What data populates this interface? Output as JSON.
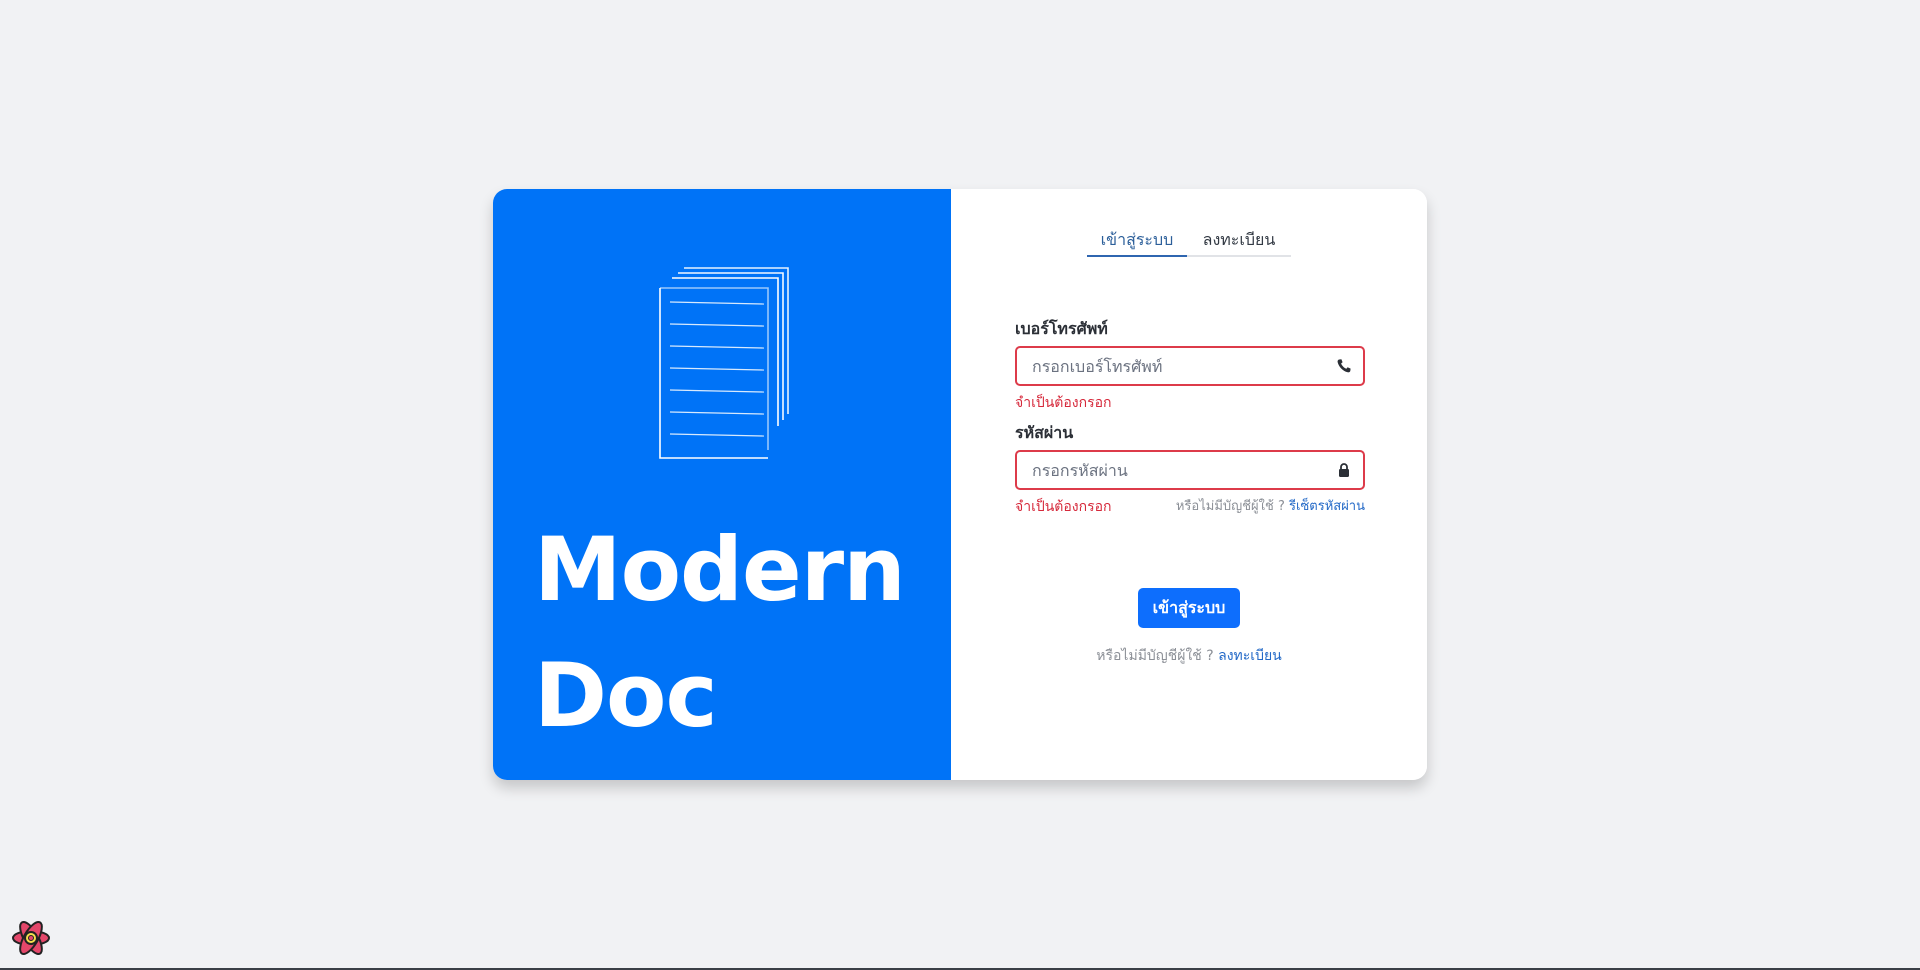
{
  "brand": {
    "title_line1": "Modern",
    "title_line2": "Doc"
  },
  "tabs": {
    "login": "เข้าสู่ระบบ",
    "register": "ลงทะเบียน",
    "active": "login"
  },
  "form": {
    "phone": {
      "label": "เบอร์โทรศัพท์",
      "placeholder": "กรอกเบอร์โทรศัพท์",
      "value": "",
      "error": "จำเป็นต้องกรอก",
      "icon": "phone-icon"
    },
    "password": {
      "label": "รหัสผ่าน",
      "placeholder": "กรอกรหัสผ่าน",
      "value": "",
      "error": "จำเป็นต้องกรอก",
      "icon": "lock-icon"
    },
    "forgot_prompt": "หรือไม่มีบัญชีผู้ใช้ ?",
    "forgot_link": "รีเซ็ตรหัสผ่าน",
    "submit_label": "เข้าสู่ระบบ",
    "register_prompt": "หรือไม่มีบัญชีผู้ใช้ ?",
    "register_link": "ลงทะเบียน"
  },
  "colors": {
    "brand_blue": "#0073f7",
    "button_blue": "#0d6efd",
    "error_red": "#d6293b",
    "link_blue": "#2369c7",
    "background": "#f1f2f4"
  }
}
